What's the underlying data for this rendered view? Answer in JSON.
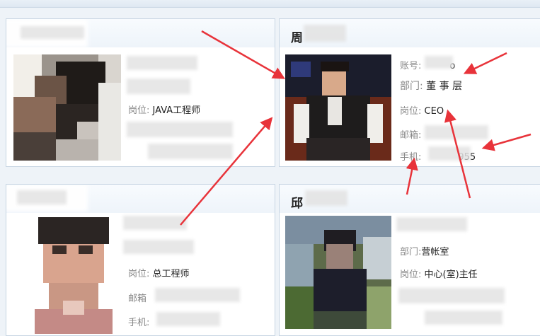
{
  "cards": [
    {
      "name": "",
      "fields": [
        {
          "label": "",
          "value": ""
        },
        {
          "label": "",
          "value": ""
        },
        {
          "label": "岗位:",
          "value": "JAVA工程师"
        },
        {
          "label": "",
          "value": ""
        },
        {
          "label": "",
          "value": ""
        }
      ]
    },
    {
      "name": "周",
      "fields": [
        {
          "label": "账号:",
          "value": "o"
        },
        {
          "label": "部门:",
          "value": "董 事 层"
        },
        {
          "label": "岗位:",
          "value": "CEO"
        },
        {
          "label": "邮箱:",
          "value": ""
        },
        {
          "label": "手机:",
          "value": "955"
        }
      ]
    },
    {
      "name": "",
      "fields": [
        {
          "label": "",
          "value": ""
        },
        {
          "label": "",
          "value": ""
        },
        {
          "label": "岗位:",
          "value": "总工程师"
        },
        {
          "label": "邮箱",
          "value": ""
        },
        {
          "label": "手机:",
          "value": ""
        }
      ]
    },
    {
      "name": "邱",
      "fields": [
        {
          "label": "",
          "value": ""
        },
        {
          "label": "部门:",
          "value": "营帐室"
        },
        {
          "label": "岗位:",
          "value": "中心(室)主任"
        },
        {
          "label": "",
          "value": ""
        },
        {
          "label": "",
          "value": ""
        }
      ]
    }
  ],
  "colors": {
    "arrow": "#e8333a",
    "card_border": "#c7d5e3",
    "header_bg": "#eef4fa"
  }
}
